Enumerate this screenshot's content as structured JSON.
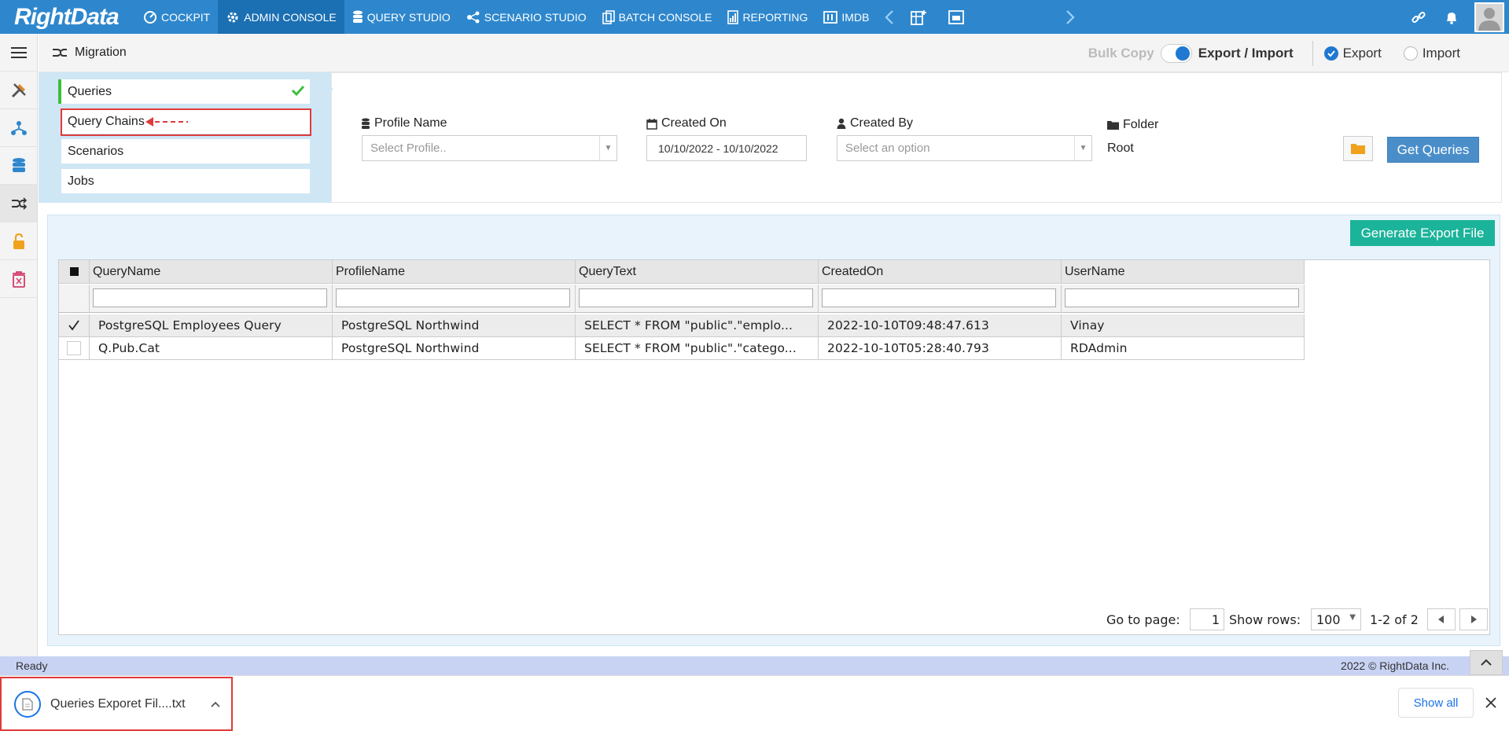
{
  "app": {
    "logo": "RightData"
  },
  "nav": [
    {
      "label": "COCKPIT",
      "icon": "cockpit-icon"
    },
    {
      "label": "ADMIN CONSOLE",
      "icon": "gear-icon",
      "active": true
    },
    {
      "label": "QUERY STUDIO",
      "icon": "database-icon"
    },
    {
      "label": "SCENARIO STUDIO",
      "icon": "scenario-icon"
    },
    {
      "label": "BATCH CONSOLE",
      "icon": "batch-icon"
    },
    {
      "label": "REPORTING",
      "icon": "report-icon"
    },
    {
      "label": "IMDB",
      "icon": "imdb-icon"
    }
  ],
  "page": {
    "title": "Migration"
  },
  "mode": {
    "bulk_copy": "Bulk Copy",
    "export_import": "Export / Import",
    "export_label": "Export",
    "import_label": "Import",
    "export_selected": true
  },
  "migration_items": [
    "Queries",
    "Query Chains",
    "Scenarios",
    "Jobs"
  ],
  "filters": {
    "profile_label": "Profile Name",
    "profile_placeholder": "Select Profile..",
    "created_on_label": "Created On",
    "created_on_value": "10/10/2022 - 10/10/2022",
    "created_by_label": "Created By",
    "created_by_placeholder": "Select an option",
    "folder_label": "Folder",
    "folder_value": "Root",
    "get_queries": "Get Queries"
  },
  "grid": {
    "generate_button": "Generate Export File",
    "columns": [
      "QueryName",
      "ProfileName",
      "QueryText",
      "CreatedOn",
      "UserName"
    ],
    "rows": [
      {
        "checked": true,
        "cells": [
          "PostgreSQL Employees Query",
          "PostgreSQL Northwind",
          "SELECT * FROM \"public\".\"emplo...",
          "2022-10-10T09:48:47.613",
          "Vinay"
        ]
      },
      {
        "checked": false,
        "cells": [
          "Q.Pub.Cat",
          "PostgreSQL Northwind",
          "SELECT * FROM \"public\".\"catego...",
          "2022-10-10T05:28:40.793",
          "RDAdmin"
        ]
      }
    ],
    "pager": {
      "go_to_page": "Go to page:",
      "page": "1",
      "show_rows": "Show rows:",
      "rows_value": "100",
      "range": "1-2 of 2"
    }
  },
  "status": {
    "left": "Ready",
    "right": "2022 © RightData Inc."
  },
  "download": {
    "filename": "Queries Exporet Fil....txt",
    "show_all": "Show all"
  },
  "colors": {
    "nav": "#2e87cd",
    "nav_active": "#1b6fb3",
    "panel": "#cfe6f5",
    "accent_green": "#1bb39a",
    "button_blue": "#4a8ec9"
  }
}
